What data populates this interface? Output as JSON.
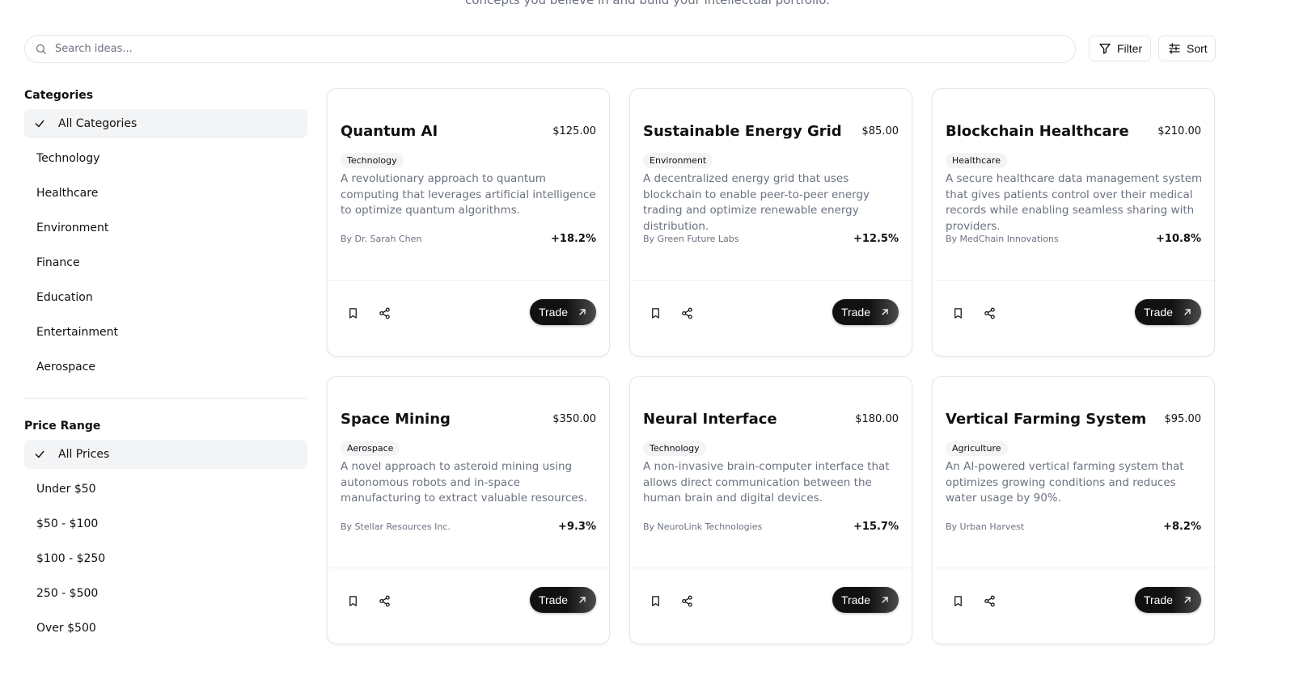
{
  "header": {
    "subtitle": "concepts you believe in and build your intellectual portfolio."
  },
  "search": {
    "placeholder": "Search ideas..."
  },
  "toolbar": {
    "filter_label": "Filter",
    "sort_label": "Sort"
  },
  "sidebar": {
    "categories_title": "Categories",
    "categories": [
      {
        "label": "All Categories",
        "selected": true
      },
      {
        "label": "Technology",
        "selected": false
      },
      {
        "label": "Healthcare",
        "selected": false
      },
      {
        "label": "Environment",
        "selected": false
      },
      {
        "label": "Finance",
        "selected": false
      },
      {
        "label": "Education",
        "selected": false
      },
      {
        "label": "Entertainment",
        "selected": false
      },
      {
        "label": "Aerospace",
        "selected": false
      }
    ],
    "price_title": "Price Range",
    "prices": [
      {
        "label": "All Prices",
        "selected": true
      },
      {
        "label": "Under $50",
        "selected": false
      },
      {
        "label": "$50 - $100",
        "selected": false
      },
      {
        "label": "$100 - $250",
        "selected": false
      },
      {
        "label": "250 - $500",
        "selected": false
      },
      {
        "label": "Over $500",
        "selected": false
      }
    ]
  },
  "ideas": [
    {
      "title": "Quantum AI",
      "price": "$125.00",
      "category": "Technology",
      "description": "A revolutionary approach to quantum computing that leverages artificial intelligence to optimize quantum algorithms.",
      "author": "By Dr. Sarah Chen",
      "change": "+18.2%",
      "trade_label": "Trade"
    },
    {
      "title": "Sustainable Energy Grid",
      "price": "$85.00",
      "category": "Environment",
      "description": "A decentralized energy grid that uses blockchain to enable peer-to-peer energy trading and optimize renewable energy distribution.",
      "author": "By Green Future Labs",
      "change": "+12.5%",
      "trade_label": "Trade"
    },
    {
      "title": "Blockchain Healthcare",
      "price": "$210.00",
      "category": "Healthcare",
      "description": "A secure healthcare data management system that gives patients control over their medical records while enabling seamless sharing with providers.",
      "author": "By MedChain Innovations",
      "change": "+10.8%",
      "trade_label": "Trade"
    },
    {
      "title": "Space Mining",
      "price": "$350.00",
      "category": "Aerospace",
      "description": "A novel approach to asteroid mining using autonomous robots and in-space manufacturing to extract valuable resources.",
      "author": "By Stellar Resources Inc.",
      "change": "+9.3%",
      "trade_label": "Trade"
    },
    {
      "title": "Neural Interface",
      "price": "$180.00",
      "category": "Technology",
      "description": "A non-invasive brain-computer interface that allows direct communication between the human brain and digital devices.",
      "author": "By NeuroLink Technologies",
      "change": "+15.7%",
      "trade_label": "Trade"
    },
    {
      "title": "Vertical Farming System",
      "price": "$95.00",
      "category": "Agriculture",
      "description": "An AI-powered vertical farming system that optimizes growing conditions and reduces water usage by 90%.",
      "author": "By Urban Harvest",
      "change": "+8.2%",
      "trade_label": "Trade"
    }
  ]
}
